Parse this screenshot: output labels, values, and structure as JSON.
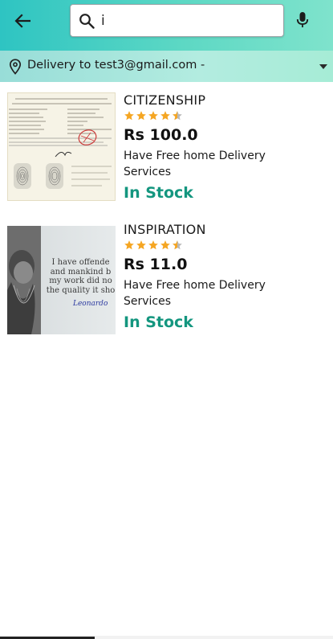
{
  "header": {
    "search": {
      "value": "i",
      "placeholder": ""
    }
  },
  "delivery": {
    "label": "Delivery to test3@gmail.com -"
  },
  "products": [
    {
      "title": "CITIZENSHIP",
      "rating": 4.5,
      "price": "Rs 100.0",
      "description": "Have Free home Delivery Services",
      "stock": "In Stock"
    },
    {
      "title": "INSPIRATION",
      "rating": 4.5,
      "price": "Rs 11.0",
      "description": "Have Free home Delivery Services",
      "stock": "In Stock",
      "image_quote": {
        "line1": "I have offende",
        "line2": "and mankind b",
        "line3": "my work did no",
        "line4": "the quality it sho",
        "signature": "Leonardo"
      }
    }
  ],
  "colors": {
    "appbar_start": "#2ec4c2",
    "appbar_end": "#7fe3cc",
    "delivery_bar": "#a6e6dc",
    "star": "#f5a623",
    "stock": "#14967f"
  },
  "icons": {
    "back": "arrow-left-icon",
    "search": "search-icon",
    "mic": "mic-icon",
    "location": "location-pin-icon",
    "dropdown": "triangle-down-icon",
    "star": "star-icon"
  }
}
